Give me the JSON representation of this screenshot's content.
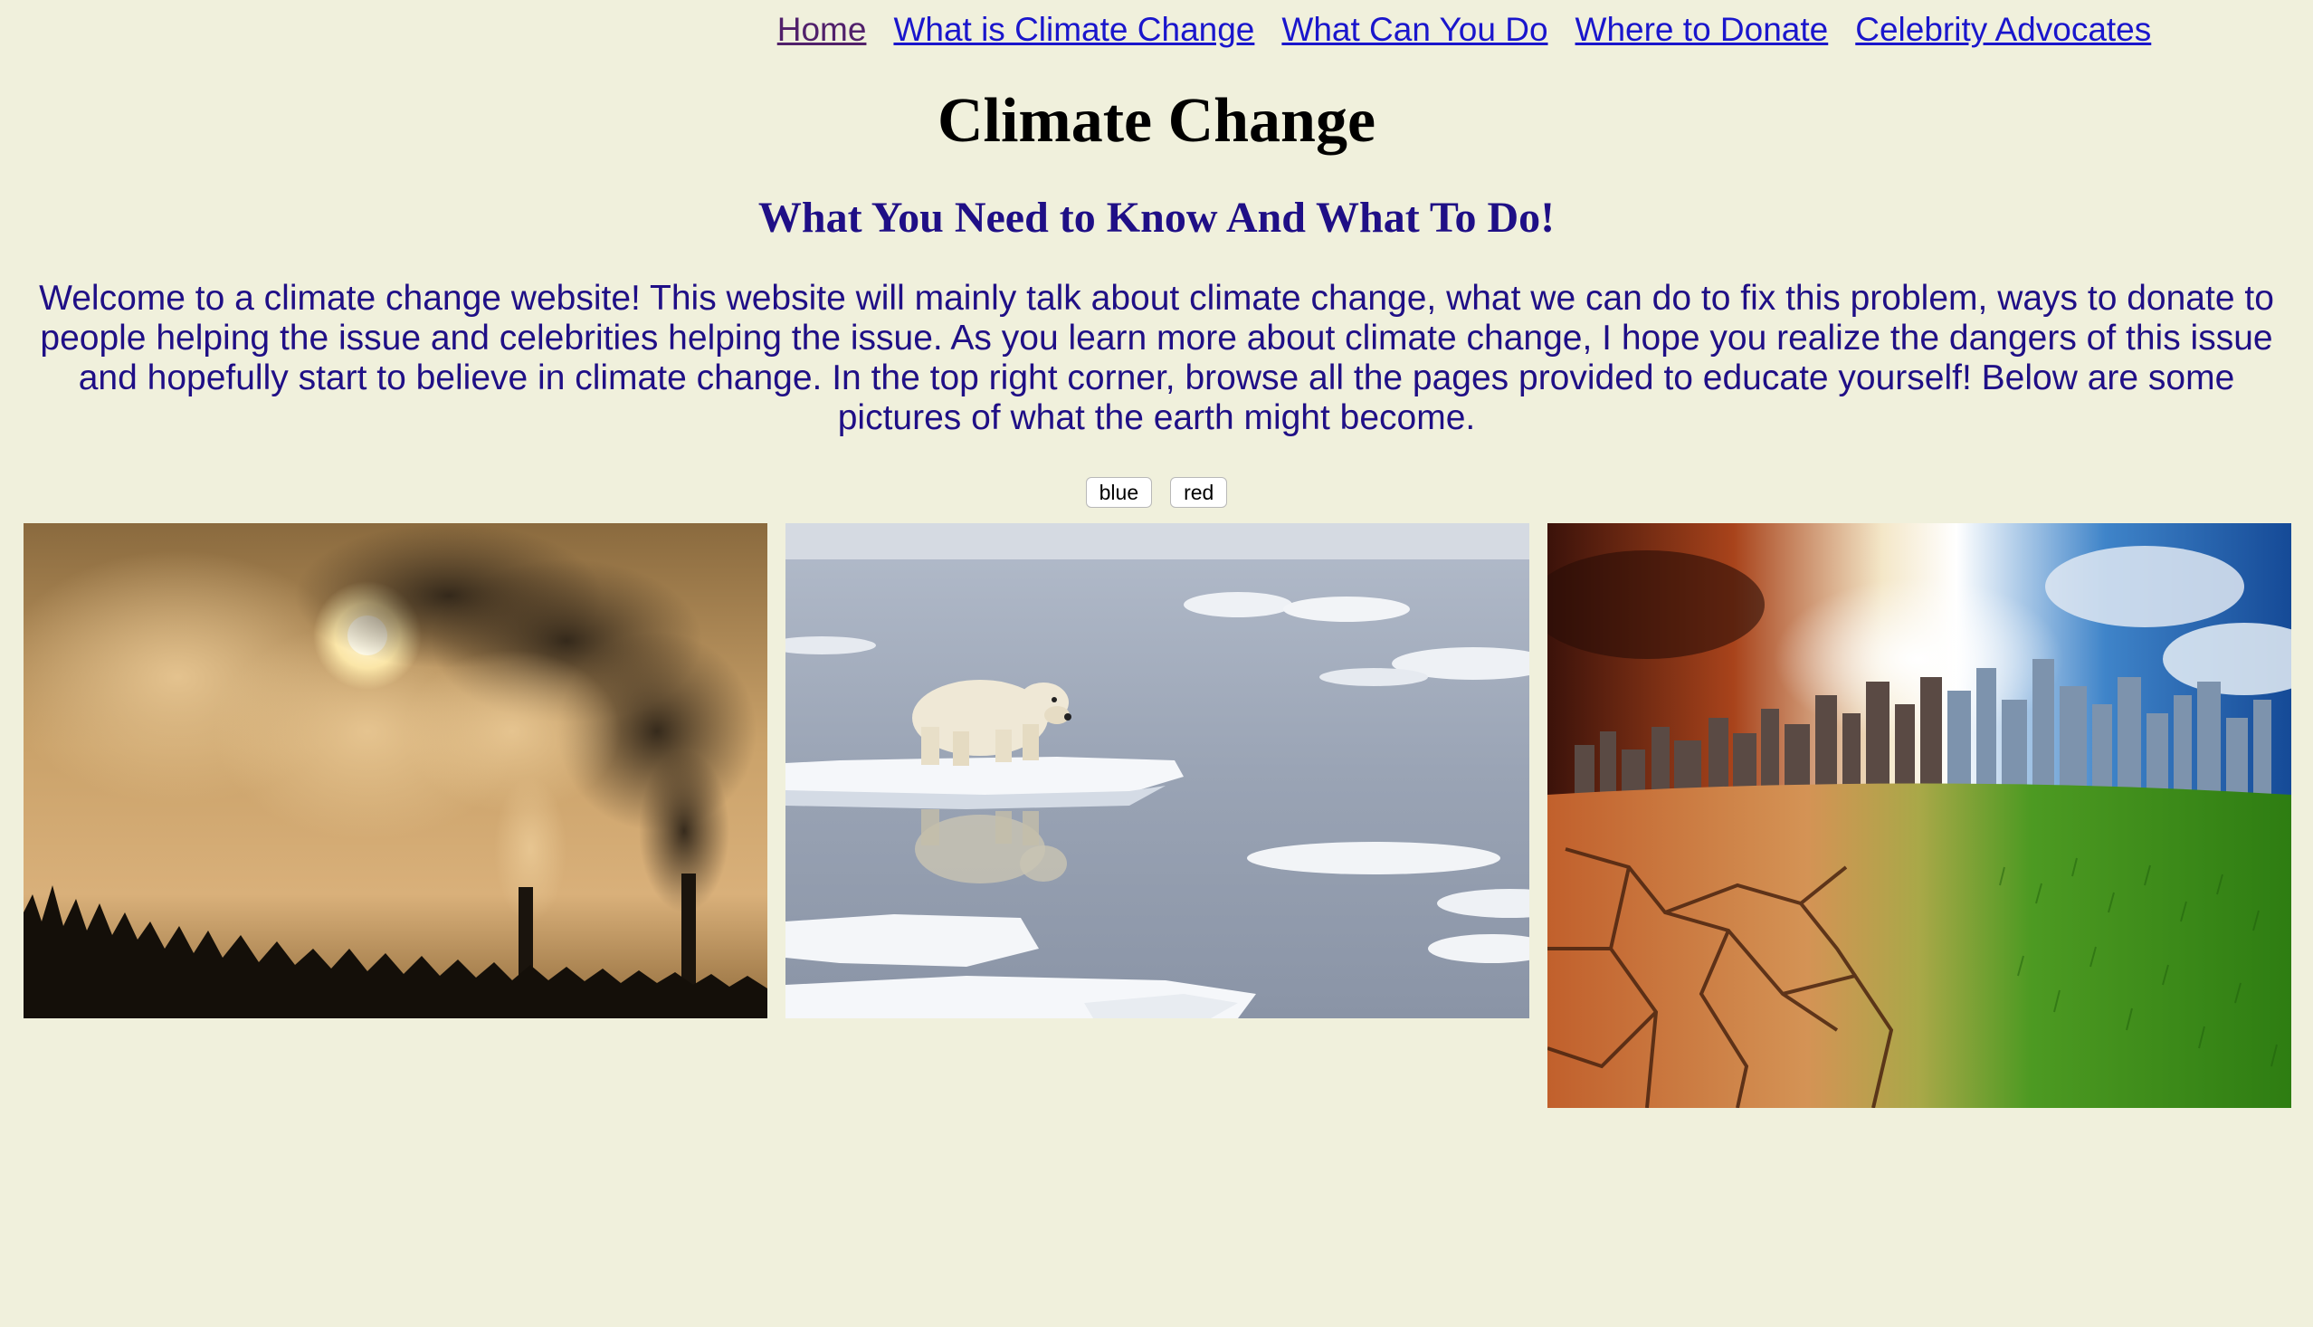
{
  "nav": {
    "items": [
      {
        "label": "Home",
        "visited": true
      },
      {
        "label": "What is Climate Change",
        "visited": false
      },
      {
        "label": "What Can You Do",
        "visited": false
      },
      {
        "label": "Where to Donate",
        "visited": false
      },
      {
        "label": "Celebrity Advocates",
        "visited": false
      }
    ]
  },
  "page": {
    "title": "Climate Change",
    "subtitle": "What You Need to Know And What To Do!",
    "intro": "Welcome to a climate change website! This website will mainly talk about climate change, what we can do to fix this problem, ways to donate to people helping the issue and celebrities helping the issue. As you learn more about climate change, I hope you realize the dangers of this issue and hopefully start to believe in climate change. In the top right corner, browse all the pages provided to educate yourself! Below are some pictures of what the earth might become."
  },
  "color_buttons": {
    "blue": "blue",
    "red": "red"
  },
  "photos": [
    {
      "subject": "factory-smokestacks-smoke-sunset"
    },
    {
      "subject": "polar-bear-on-melting-ice"
    },
    {
      "subject": "city-cracked-earth-green-grass"
    }
  ],
  "colors": {
    "background": "#f0f0dc",
    "link": "#1a16cc",
    "visited_link": "#51206b",
    "heading": "#000000",
    "subheading": "#1f0f86",
    "body_text": "#1f0f86"
  }
}
